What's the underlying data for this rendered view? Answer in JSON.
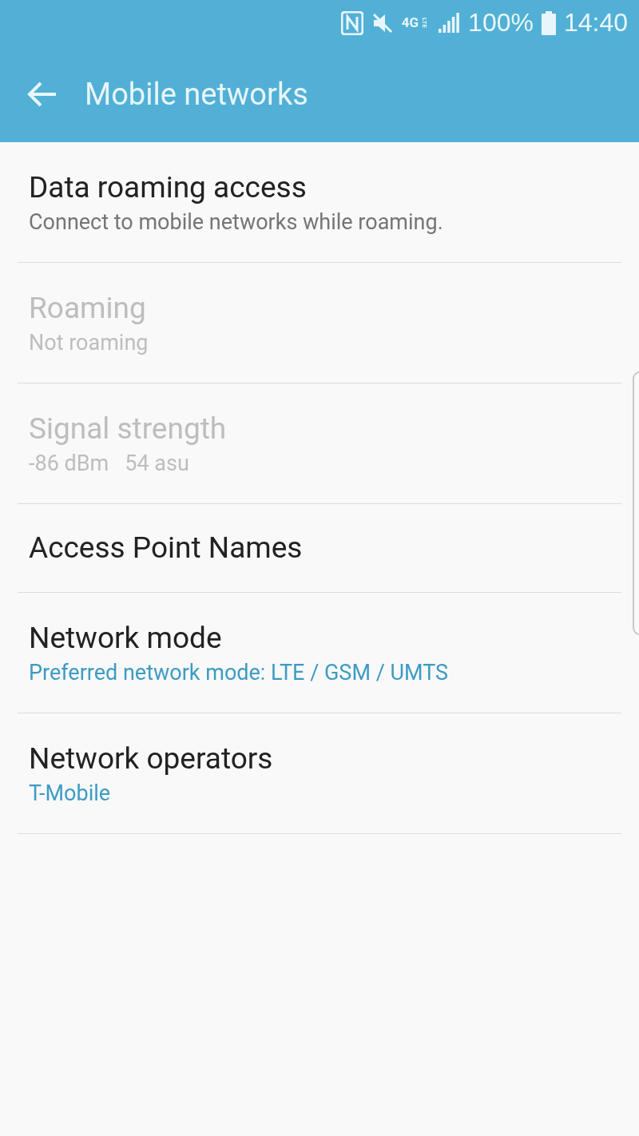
{
  "status_bar": {
    "network_type": "4G",
    "network_sub": "LTE",
    "battery": "100%",
    "time": "14:40"
  },
  "toolbar": {
    "title": "Mobile networks"
  },
  "items": [
    {
      "title": "Data roaming access",
      "summary": "Connect to mobile networks while roaming.",
      "kind": "description",
      "disabled": false
    },
    {
      "title": "Roaming",
      "summary": "Not roaming",
      "kind": "description",
      "disabled": true
    },
    {
      "title": "Signal strength",
      "summary": "-86 dBm   54 asu",
      "kind": "description",
      "disabled": true
    },
    {
      "title": "Access Point Names",
      "disabled": false
    },
    {
      "title": "Network mode",
      "summary": "Preferred network mode: LTE / GSM / UMTS",
      "kind": "value",
      "disabled": false
    },
    {
      "title": "Network operators",
      "summary": "T-Mobile",
      "kind": "value",
      "disabled": false
    }
  ]
}
